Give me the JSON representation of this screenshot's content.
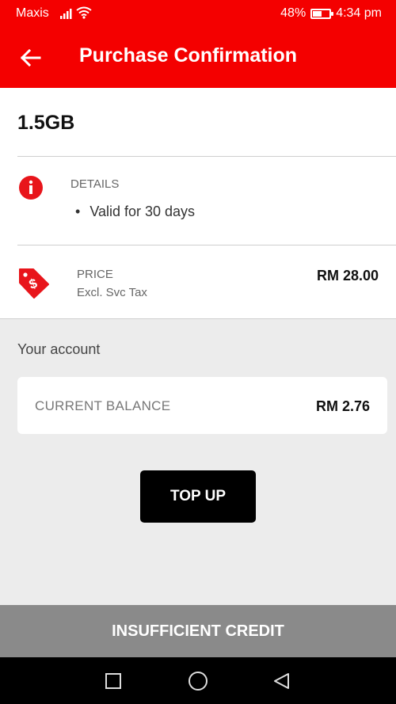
{
  "status_bar": {
    "carrier": "Maxis",
    "battery": "48%",
    "time": "4:34 pm"
  },
  "app_bar": {
    "title": "Purchase Confirmation",
    "back_icon": "arrow-left-icon"
  },
  "plan": {
    "name": "1.5GB"
  },
  "details": {
    "label": "DETAILS",
    "icon": "info-icon",
    "items": [
      "Valid for 30 days"
    ]
  },
  "price": {
    "label": "PRICE",
    "sublabel": "Excl. Svc Tax",
    "value": "RM 28.00",
    "icon": "price-tag-icon"
  },
  "account": {
    "title": "Your account",
    "balance_label": "CURRENT BALANCE",
    "balance_value": "RM 2.76"
  },
  "actions": {
    "top_up": "TOP UP",
    "insufficient": "INSUFFICIENT CREDIT"
  },
  "colors": {
    "brand": "#f40000",
    "button": "#000000",
    "disabled": "#8a8a8a"
  }
}
